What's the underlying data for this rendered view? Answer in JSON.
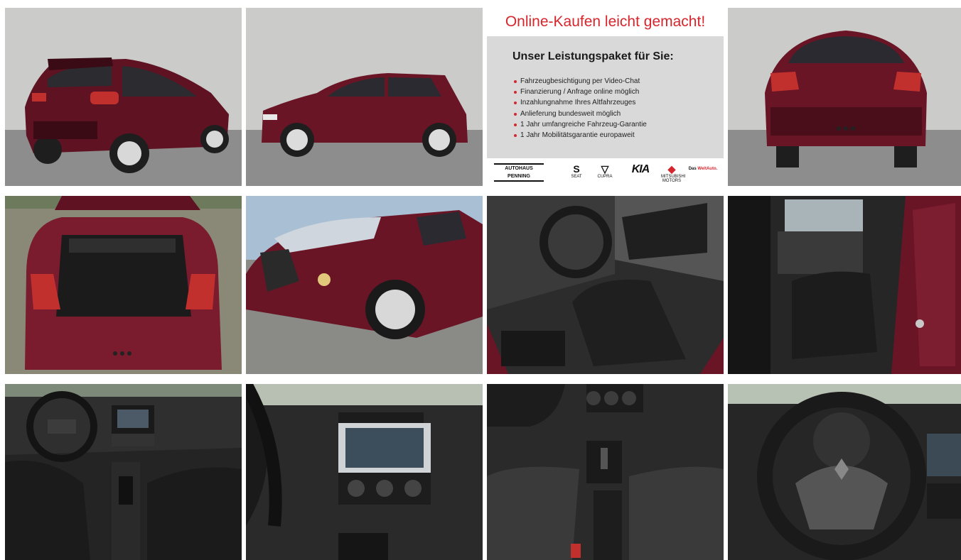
{
  "gallery": {
    "tiles": [
      {
        "name": "car-rear-three-quarter"
      },
      {
        "name": "car-side-profile"
      },
      {
        "name": "promo-banner"
      },
      {
        "name": "car-rear-view"
      },
      {
        "name": "trunk-open"
      },
      {
        "name": "front-headlight-detail"
      },
      {
        "name": "driver-seat-interior"
      },
      {
        "name": "rear-seats-interior"
      },
      {
        "name": "dashboard-overview"
      },
      {
        "name": "infotainment-center-console"
      },
      {
        "name": "gear-shift-front-seats"
      },
      {
        "name": "steering-wheel-closeup"
      }
    ]
  },
  "promo": {
    "headline": "Online-Kaufen leicht gemacht!",
    "title": "Unser Leistungspaket für Sie:",
    "items": [
      "Fahrzeugbesichtigung per Video-Chat",
      "Finanzierung / Anfrage online möglich",
      "Inzahlungnahme Ihres Altfahrzeuges",
      "Anlieferung bundesweit möglich",
      "1 Jahr umfangreiche Fahrzeug-Garantie",
      "1 Jahr Mobilitätsgarantie europaweit"
    ],
    "dealer_line1": "AUTOHAUS",
    "dealer_line2": "PENNING",
    "brands": {
      "seat": "SEAT",
      "cupra": "CUPRA",
      "kia": "KIA",
      "mitsubishi": "MITSUBISHI MOTORS",
      "vw_prefix": "Das ",
      "vw_highlight": "WeltAuto."
    }
  },
  "colors": {
    "car_paint": "#6a1526",
    "promo_red": "#d6262d",
    "studio_wall": "#c9c9c7",
    "studio_floor": "#8f8f8f",
    "interior_dark": "#2a2a2a"
  },
  "icons": {
    "mitsubishi": "mitsubishi-diamond-icon",
    "seat": "seat-s-icon",
    "cupra": "cupra-triangle-icon"
  }
}
